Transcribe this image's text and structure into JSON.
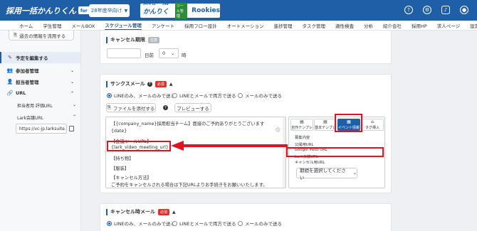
{
  "header": {
    "logo_text": "採用一括かんりくん",
    "logo_for": "for 新卒",
    "year_select": "28年度卒向け",
    "logo2_text": "採用一括かんりくん",
    "logo2_tag": "ツール管理",
    "logo2_rookies": "Rookies"
  },
  "nav": {
    "items": [
      "ホーム",
      "学生管理",
      "メールBOX",
      "スケジュール管理",
      "アンケート",
      "採用フロー設計",
      "オートメーション",
      "進捗管理",
      "タスク管理",
      "適性検査",
      "分析",
      "紹介会社",
      "採用HP",
      "求人ページ",
      "設定"
    ],
    "active_index": 3
  },
  "sidebar": {
    "past_info_button": "過去の情報を流用する",
    "edit_plan": "予定を編集する",
    "participants": "参加者管理",
    "staff": "担当者管理",
    "url": "URL",
    "staff_eval_url": "担当者用 評価URL",
    "lark_url_label": "Lark会議URL",
    "lark_url_value": "https://vc-jp.larksuite.co"
  },
  "cancel_deadline": {
    "title": "キャンセル期限",
    "badge": "任意",
    "days_value": "",
    "days_label": "日前",
    "hour_value": "0",
    "hour_label": "時"
  },
  "thanks_mail": {
    "title": "サンクスメール",
    "badge": "必須",
    "radio_options": [
      "LINEのみ、メールのみで送る",
      "LINEとメールで両方で送る",
      "メールのみで送る"
    ],
    "selected_radio": 0,
    "attach_button": "ファイルを添付する",
    "preview_button": "プレビューする",
    "editor_lines": [
      "【{company_name}採用担当チーム】面接のご予約ありがとうございます",
      "{date}",
      "【会議ツールURL】",
      "{lark_video_meeting_url}",
      "【持ち物】",
      "【服装】",
      "【キャンセル方法】",
      "ご予約をキャンセルされる場合は下記URLよりお手続きをお願いいたします。"
    ],
    "tabs": [
      "自作テンプレ",
      "基本テンプレ",
      "イベント情報",
      "タグ挿入"
    ],
    "active_tab": 2,
    "tab_options": [
      "募集内容",
      "公開用URL",
      "Google Meet URL",
      "Lark会議URL",
      "キャンセル用URL"
    ],
    "highlighted_option": 3,
    "period_select": "期間を選択してください"
  },
  "cancel_mail": {
    "title": "キャンセル時メール",
    "badge": "必須",
    "radio_options": [
      "LINEのみ、メールのみで送る",
      "LINEとメールで両方で送る",
      "メールのみで送る"
    ],
    "selected_radio": 0
  },
  "colors": {
    "brand": "#1f5fa8",
    "highlight_red": "#e0141e",
    "required_red": "#d9342b"
  }
}
